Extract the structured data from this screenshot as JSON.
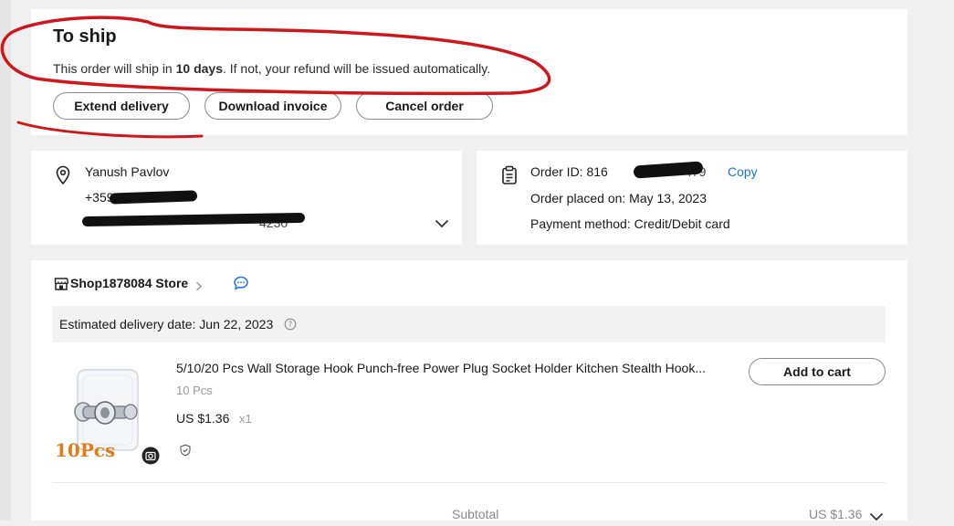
{
  "status": {
    "title": "To ship",
    "message_before": "This order will ship in ",
    "message_days": "10 days",
    "message_after": ". If not, your refund will be issued automatically.",
    "buttons": {
      "extend": "Extend delivery",
      "invoice": "Download invoice",
      "cancel": "Cancel order"
    }
  },
  "address": {
    "name": "Yanush Pavlov",
    "phone_visible": "+359",
    "line_visible": "4230"
  },
  "order": {
    "id_label": "Order ID: ",
    "id_visible_prefix": "816",
    "id_visible_suffix": "479",
    "copy": "Copy",
    "placed": "Order placed on: May 13, 2023",
    "payment": "Payment method: Credit/Debit card"
  },
  "store": {
    "name": "Shop1878084 Store"
  },
  "delivery": {
    "estimate": "Estimated delivery date: Jun 22, 2023"
  },
  "item": {
    "image_caption": "10Pcs",
    "title": "5/10/20 Pcs Wall Storage Hook Punch-free Power Plug Socket Holder Kitchen Stealth Hook...",
    "variant": "10 Pcs",
    "price": "US $1.36",
    "qty": "x1",
    "add_to_cart": "Add to cart"
  },
  "summary": {
    "subtotal_label": "Subtotal",
    "subtotal_value": "US $1.36"
  },
  "colors": {
    "accent_link": "#1a73e8",
    "annotation_red": "#d0161d",
    "caption_orange": "#e07d1a"
  }
}
